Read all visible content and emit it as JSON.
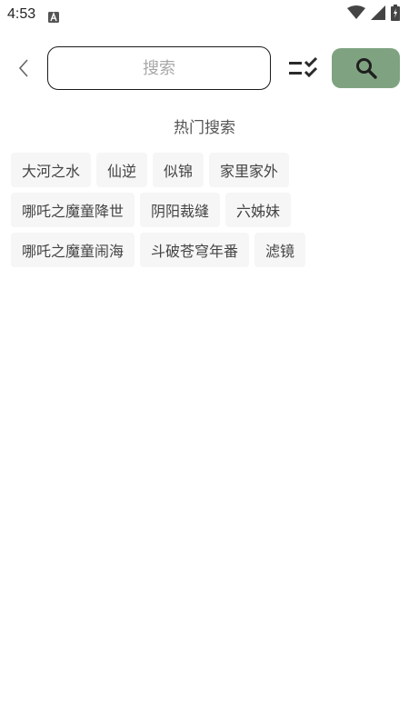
{
  "status_bar": {
    "time": "4:53"
  },
  "search": {
    "placeholder": "搜索",
    "value": ""
  },
  "hot_search": {
    "title": "热门搜索",
    "rows": [
      [
        "大河之水",
        "仙逆",
        "似锦",
        "家里家外"
      ],
      [
        "哪吒之魔童降世",
        "阴阳裁缝",
        "六姊妹"
      ],
      [
        "哪吒之魔童闹海",
        "斗破苍穹年番",
        "滤镜"
      ]
    ]
  },
  "colors": {
    "accent": "#7fa381",
    "tag_bg": "#f6f6f6"
  }
}
